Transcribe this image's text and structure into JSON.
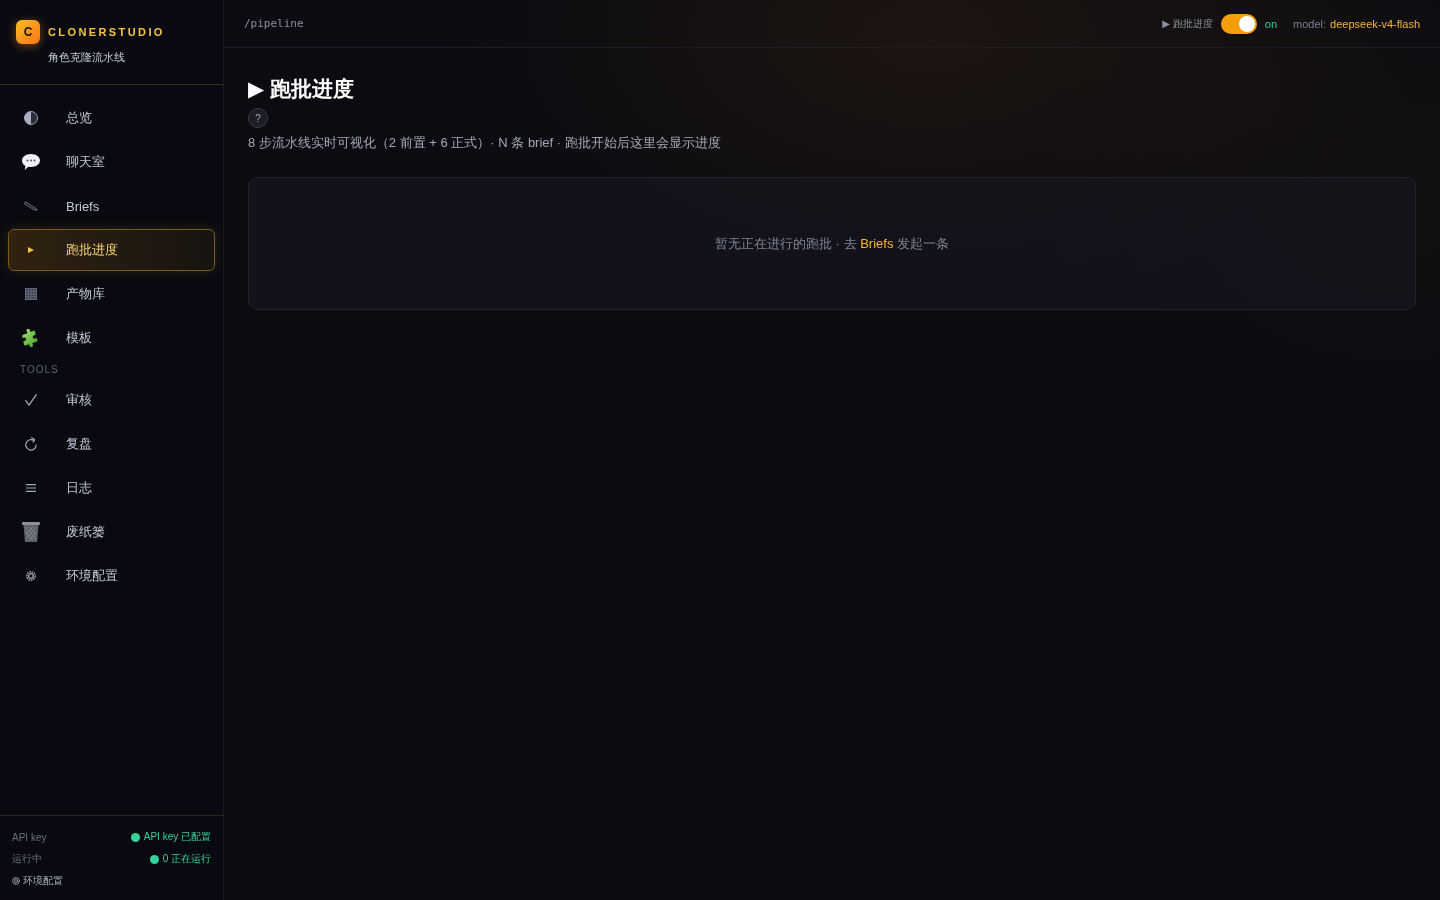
{
  "brand": {
    "logo_letter": "C",
    "name": "CLONERSTUDIO",
    "subtitle": "角色克隆流水线"
  },
  "sidebar": {
    "items": [
      {
        "label": "总览",
        "selected": false
      },
      {
        "label": "聊天室",
        "selected": false
      },
      {
        "label": "Briefs",
        "selected": false
      },
      {
        "label": "跑批进度",
        "selected": true
      },
      {
        "label": "产物库",
        "selected": false
      },
      {
        "label": "模板",
        "selected": false
      }
    ],
    "tools_heading": "TOOLS",
    "tools": [
      {
        "label": "审核",
        "selected": false
      },
      {
        "label": "复盘",
        "selected": false
      },
      {
        "label": "日志",
        "selected": false
      },
      {
        "label": "废纸篓",
        "selected": false
      },
      {
        "label": "环境配置",
        "selected": false
      }
    ]
  },
  "sidebar_footer": {
    "rows": [
      {
        "label": "API key",
        "status": "API key 已配置",
        "color": "#34d399"
      },
      {
        "label": "运行中",
        "status": "0 正在运行",
        "color": "#34d399"
      }
    ],
    "settings_link": "环境配置"
  },
  "topbar": {
    "path": "/pipeline",
    "page_indicator": "▶ 跑批进度",
    "toggle": {
      "on": true,
      "label": "on"
    },
    "model_label": "model:",
    "model": "deepseek-v4-flash"
  },
  "page": {
    "title": "▶ 跑批进度",
    "help": "?",
    "description": "8 步流水线实时可视化（2 前置 + 6 正式）· N 条 brief · 跑批开始后这里会显示进度",
    "empty_state": {
      "before": "暂无正在进行的跑批 · 去 ",
      "link": "Briefs",
      "after": " 发起一条"
    }
  }
}
